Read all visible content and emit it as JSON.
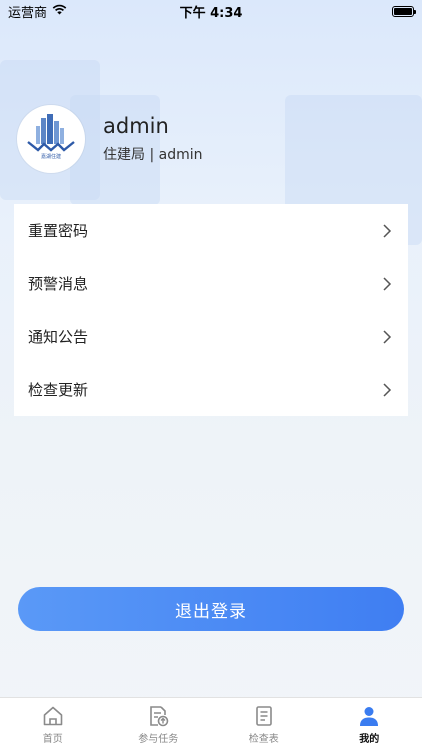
{
  "status_bar": {
    "carrier": "运营商",
    "time": "下午 4:34"
  },
  "profile": {
    "avatar_logo_text": "嘉湖住建",
    "username": "admin",
    "subtitle": "住建局 | admin"
  },
  "menu": {
    "items": [
      {
        "label": "重置密码"
      },
      {
        "label": "预警消息"
      },
      {
        "label": "通知公告"
      },
      {
        "label": "检查更新"
      }
    ]
  },
  "logout_label": "退出登录",
  "tabbar": {
    "tabs": [
      {
        "label": "首页",
        "icon": "home-icon"
      },
      {
        "label": "参与任务",
        "icon": "task-upload-icon"
      },
      {
        "label": "检查表",
        "icon": "document-icon"
      },
      {
        "label": "我的",
        "icon": "person-icon",
        "active": true
      }
    ]
  },
  "colors": {
    "accent": "#3f7ef2",
    "tab_active": "#3a7cf0",
    "tab_inactive": "#8a8a8a"
  }
}
